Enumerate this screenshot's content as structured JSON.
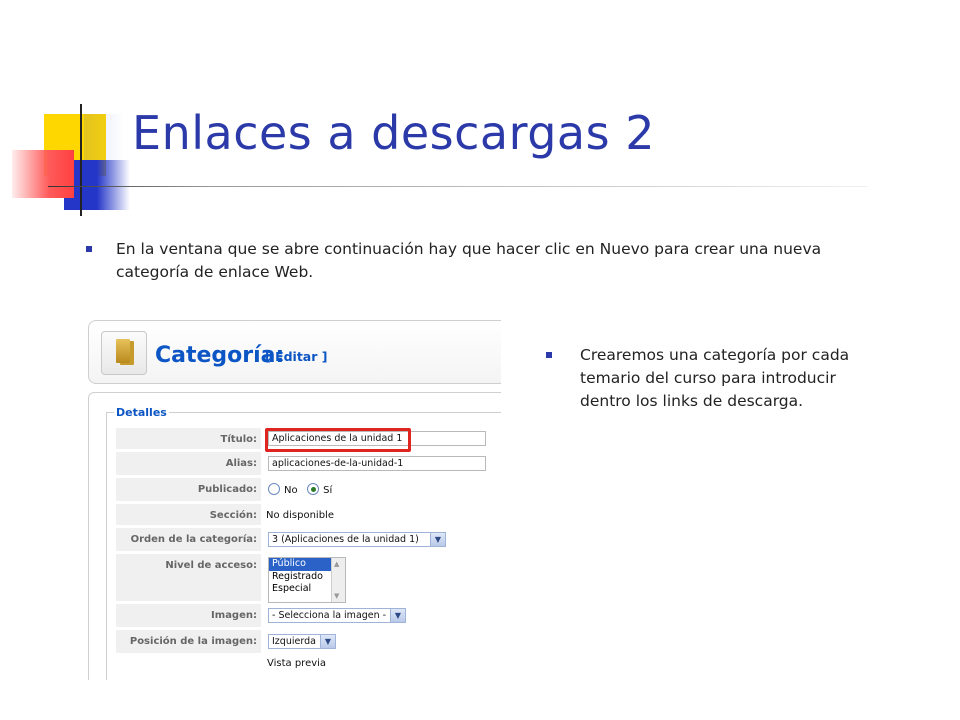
{
  "slide": {
    "title": "Enlaces a descargas 2",
    "bullet_1": "En la ventana que se abre continuación hay que hacer clic en Nuevo para crear una nueva categoría de enlace Web.",
    "bullet_2": "Crearemos una categoría por cada temario del curso para introducir dentro los links de descarga.",
    "accent_color": "#2b3aa8"
  },
  "screenshot": {
    "header": {
      "title": "Categoría:",
      "action": "[ Editar ]",
      "icon": "category-folder-icon"
    },
    "details": {
      "legend": "Detalles",
      "fields": {
        "titulo_label": "Título:",
        "titulo_value": "Aplicaciones de la unidad 1",
        "alias_label": "Alias:",
        "alias_value": "aplicaciones-de-la-unidad-1",
        "publicado_label": "Publicado:",
        "publicado_no": "No",
        "publicado_si": "Sí",
        "publicado_selected": "Sí",
        "seccion_label": "Sección:",
        "seccion_value": "No disponible",
        "orden_label": "Orden de la categoría:",
        "orden_value": "3 (Aplicaciones de la unidad 1)",
        "nivel_label": "Nivel de acceso:",
        "nivel_options": [
          "Público",
          "Registrado",
          "Especial"
        ],
        "nivel_selected": "Público",
        "imagen_label": "Imagen:",
        "imagen_value": "- Selecciona la imagen -",
        "posicion_label": "Posición de la imagen:",
        "posicion_value": "Izquierda",
        "vista_previa": "Vista previa"
      }
    },
    "highlight_color": "#e0241f"
  }
}
